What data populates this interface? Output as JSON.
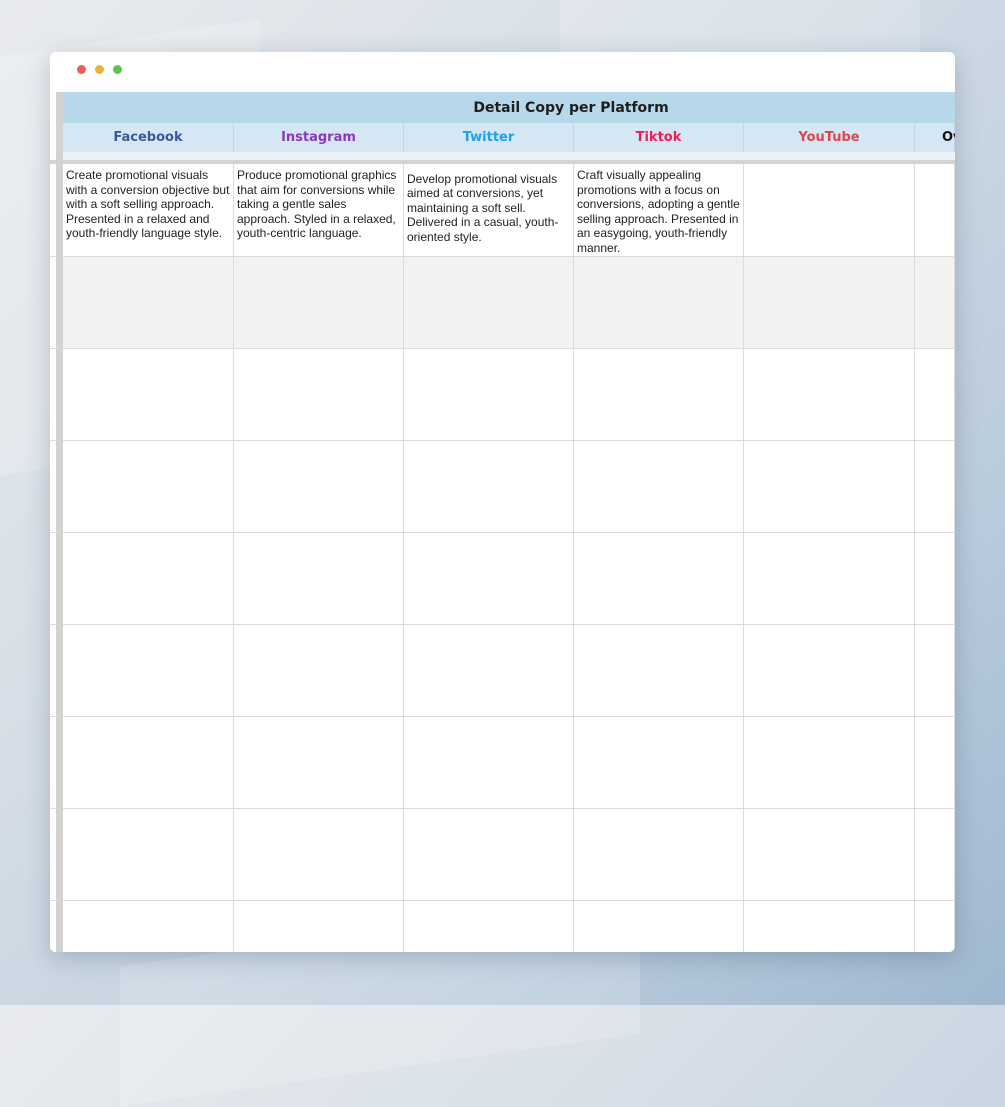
{
  "sheet": {
    "banner_title": "Detail Copy per Platform",
    "columns": [
      {
        "label": "Facebook",
        "color": "#3b5998"
      },
      {
        "label": "Instagram",
        "color": "#8a3ab9"
      },
      {
        "label": "Twitter",
        "color": "#1da1f2"
      },
      {
        "label": "Tiktok",
        "color": "#ee1d52"
      },
      {
        "label": "YouTube",
        "color": "#e0474c"
      },
      {
        "label": "Ov",
        "color": "#111111"
      }
    ],
    "rows": [
      [
        "Create promotional visuals with a conversion objective but with a soft selling approach. Presented in a relaxed and youth-friendly language style.",
        "Produce promotional graphics that aim for conversions while taking a gentle sales approach. Styled in a relaxed, youth-centric language.",
        "Develop promotional visuals aimed at conversions, yet maintaining a soft sell. Delivered in a casual, youth-oriented style.",
        "Craft visually appealing promotions with a focus on conversions, adopting a gentle selling approach. Presented in an easygoing, youth-friendly manner.",
        "",
        ""
      ],
      [
        "",
        "",
        "",
        "",
        "",
        ""
      ],
      [
        "",
        "",
        "",
        "",
        "",
        ""
      ],
      [
        "",
        "",
        "",
        "",
        "",
        ""
      ],
      [
        "",
        "",
        "",
        "",
        "",
        ""
      ],
      [
        "",
        "",
        "",
        "",
        "",
        ""
      ],
      [
        "",
        "",
        "",
        "",
        "",
        ""
      ],
      [
        "",
        "",
        "",
        "",
        "",
        ""
      ],
      [
        "",
        "",
        "",
        "",
        "",
        ""
      ]
    ]
  }
}
